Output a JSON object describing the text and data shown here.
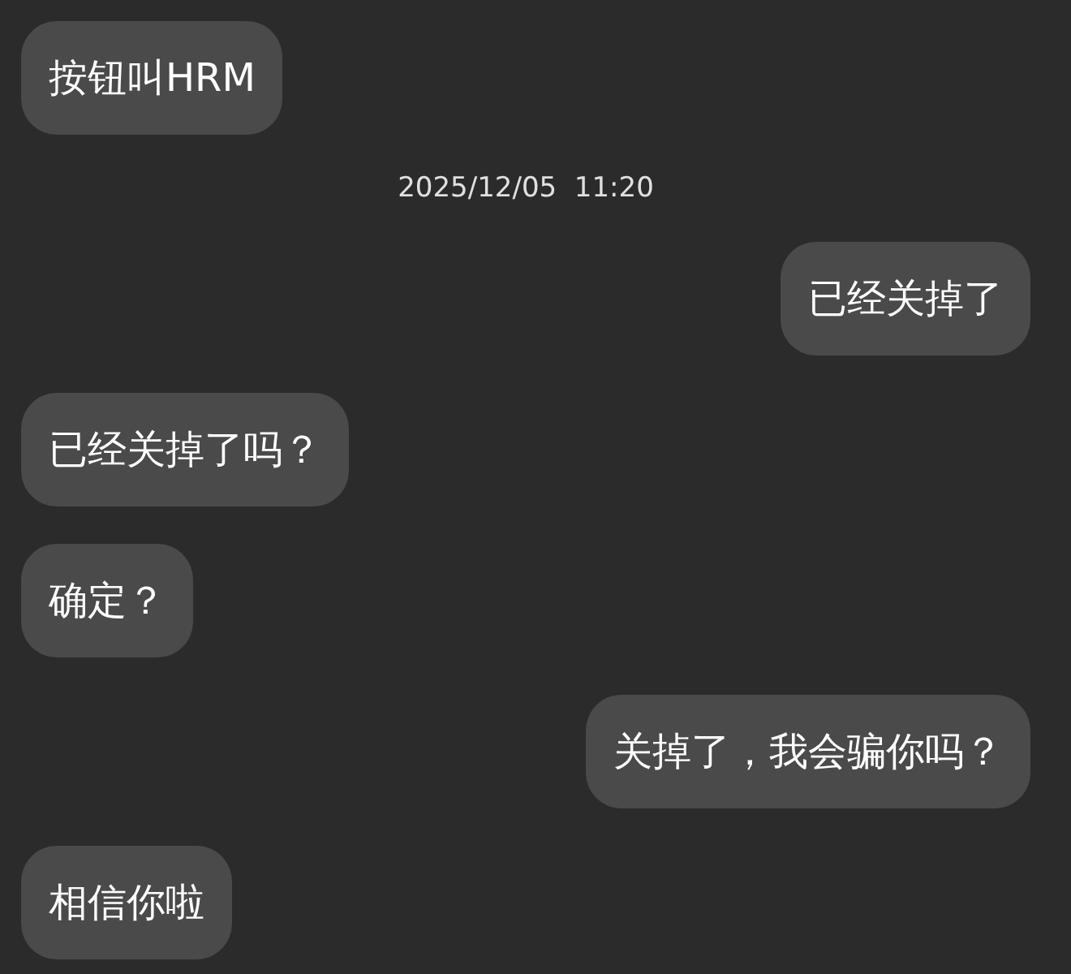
{
  "messages": [
    {
      "kind": "incoming",
      "text": "按钮叫HRM"
    },
    {
      "kind": "timestamp",
      "text": "2025/12/05  11:20"
    },
    {
      "kind": "outgoing",
      "text": "已经关掉了"
    },
    {
      "kind": "incoming",
      "text": "已经关掉了吗？"
    },
    {
      "kind": "incoming",
      "text": "确定？"
    },
    {
      "kind": "outgoing",
      "text": "关掉了，我会骗你吗？"
    },
    {
      "kind": "incoming",
      "text": "相信你啦"
    }
  ]
}
